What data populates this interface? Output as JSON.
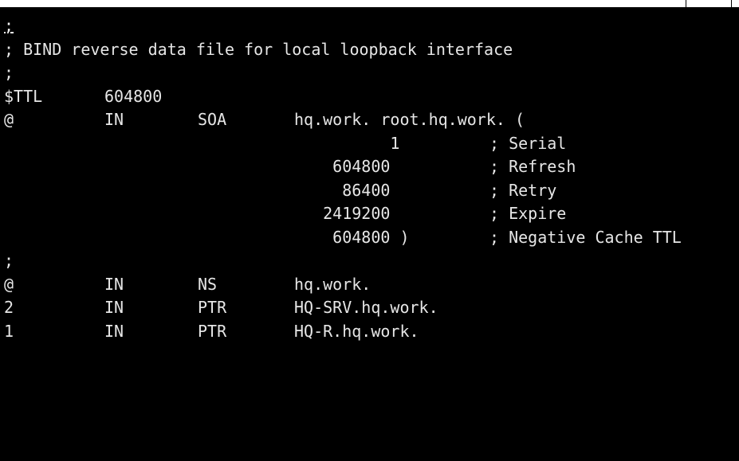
{
  "terminal": {
    "lines": [
      {
        "c0": ";"
      },
      {
        "c0": "; BIND reverse data file for local loopback interface"
      },
      {
        "c0": ";"
      },
      {
        "c0": "$TTL",
        "c1": "604800"
      },
      {
        "c0": "@",
        "c1": "IN",
        "c2": "SOA",
        "c3": "hq.work. root.hq.work. ("
      },
      {
        "c3": "          1",
        "c4": "; Serial"
      },
      {
        "c3": "    604800",
        "c4": "; Refresh"
      },
      {
        "c3": "     86400",
        "c4": "; Retry"
      },
      {
        "c3": "   2419200",
        "c4": "; Expire"
      },
      {
        "c3": "    604800 )",
        "c4": "; Negative Cache TTL"
      },
      {
        "c0": ";"
      },
      {
        "c0": "@",
        "c1": "IN",
        "c2": "NS",
        "c3": "hq.work."
      },
      {
        "c0": "2",
        "c1": "IN",
        "c2": "PTR",
        "c3": "HQ-SRV.hq.work."
      },
      {
        "c0": "1",
        "c1": "IN",
        "c2": "PTR",
        "c3": "HQ-R.hq.work."
      }
    ]
  }
}
